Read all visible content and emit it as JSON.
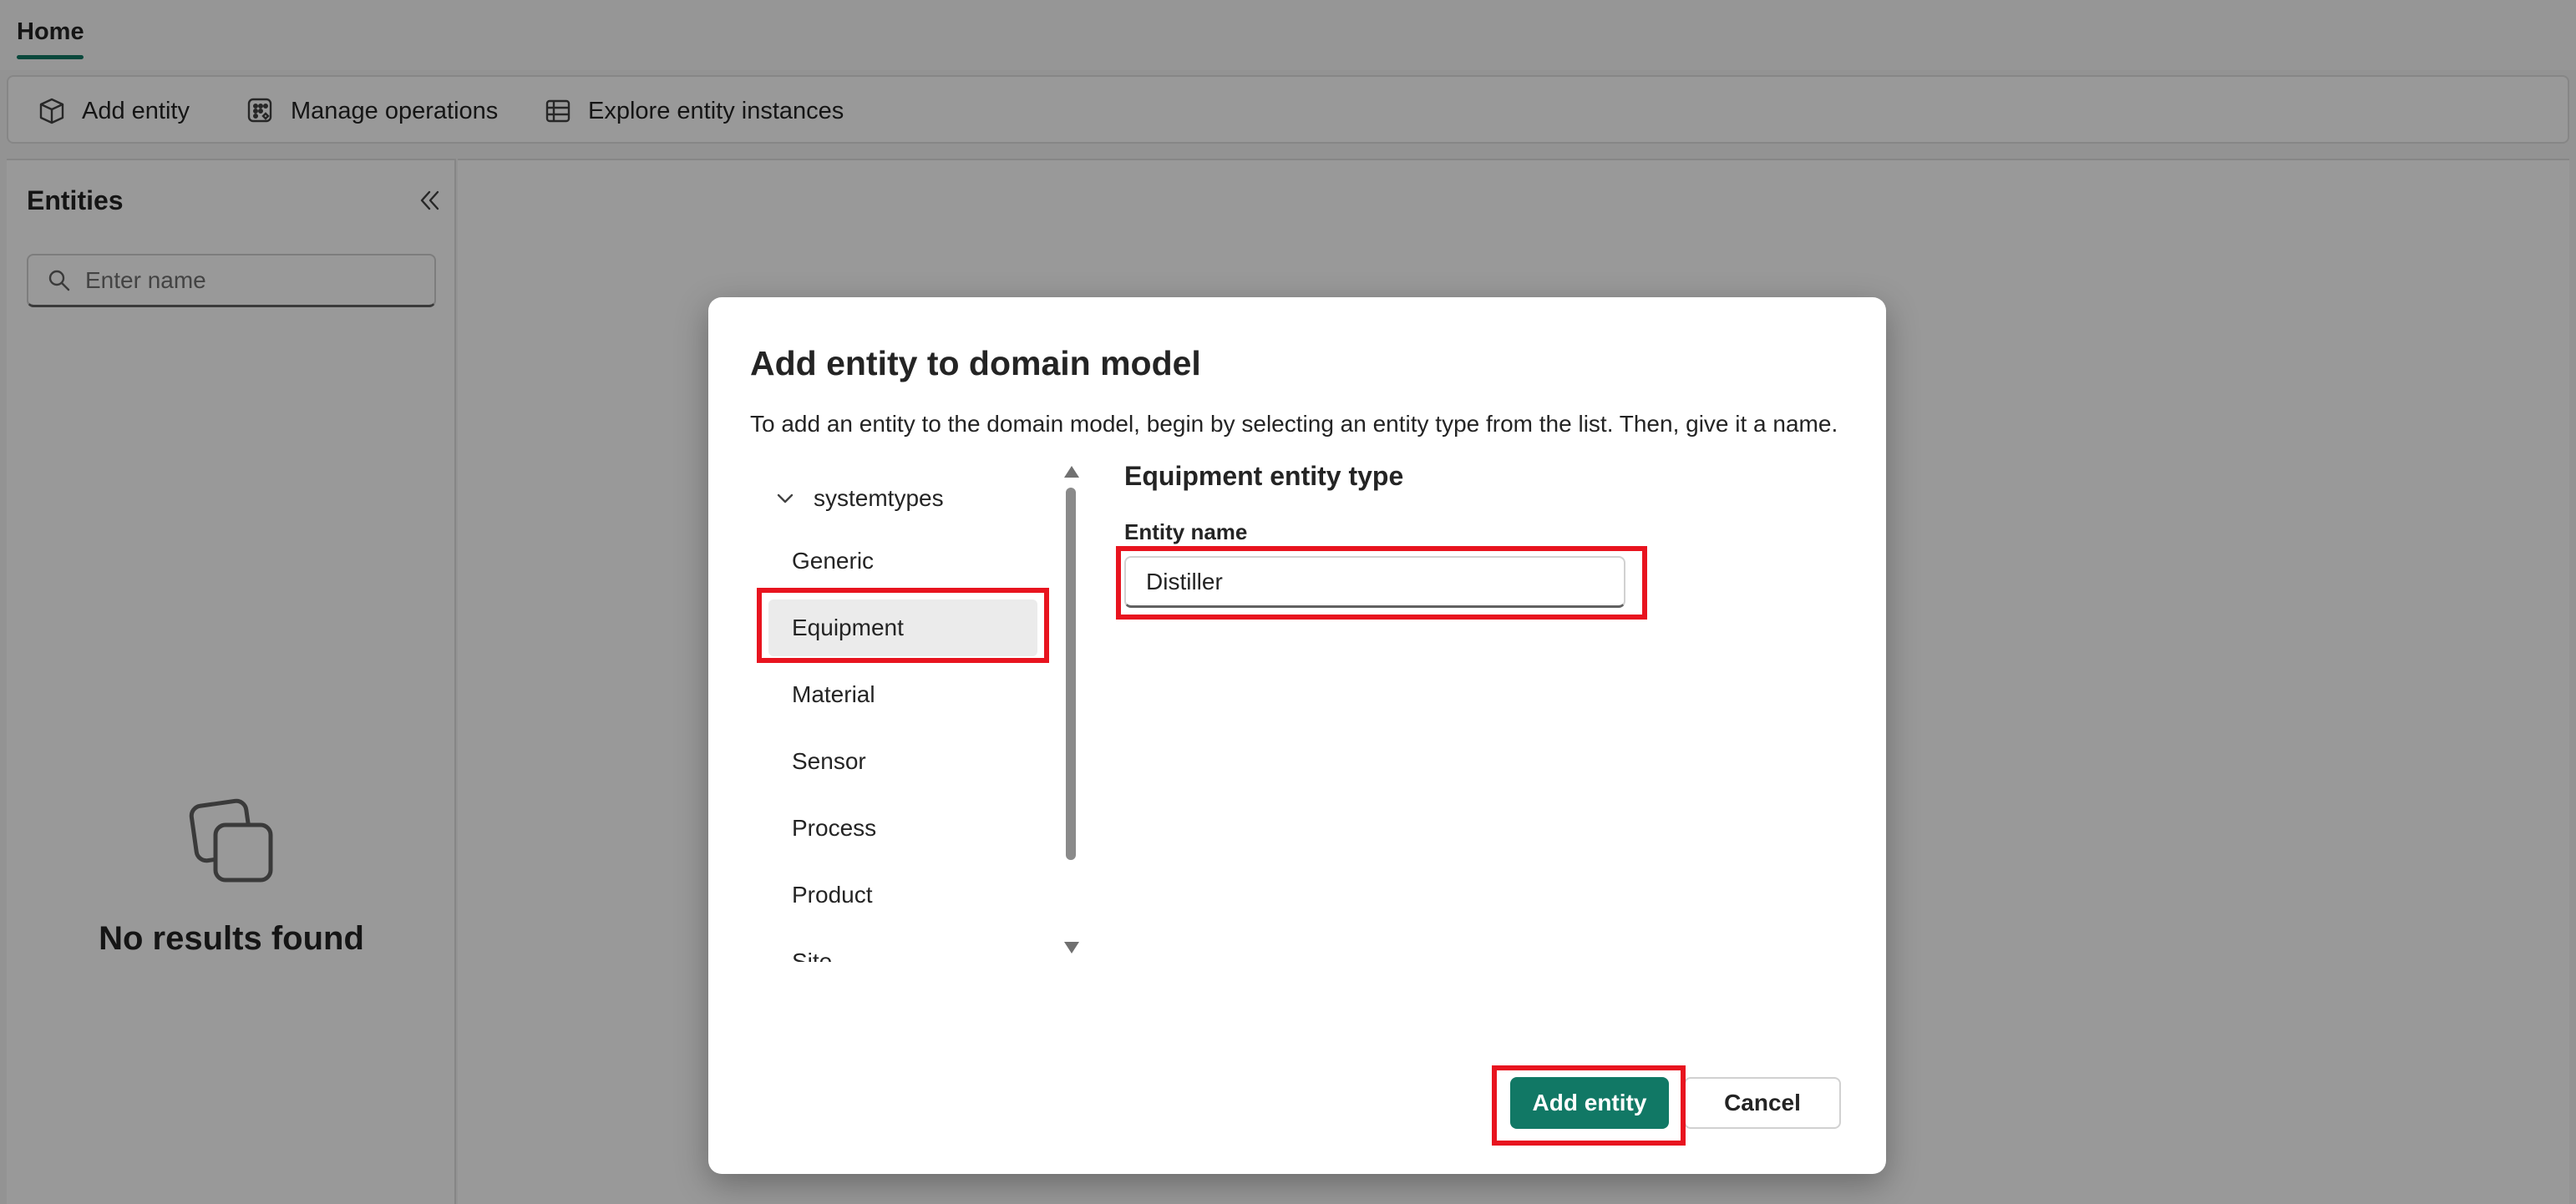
{
  "tabs": {
    "home": "Home"
  },
  "toolbar": {
    "add_entity": "Add entity",
    "manage_operations": "Manage operations",
    "explore_instances": "Explore entity instances"
  },
  "sidebar": {
    "title": "Entities",
    "search_placeholder": "Enter name",
    "empty_text": "No results found"
  },
  "dialog": {
    "title": "Add entity to domain model",
    "description": "To add an entity to the domain model, begin by selecting an entity type from the list. Then, give it a name.",
    "tree": {
      "root": "systemtypes",
      "items": [
        "Generic",
        "Equipment",
        "Material",
        "Sensor",
        "Process",
        "Product",
        "Site"
      ],
      "selected": "Equipment"
    },
    "type_heading": "Equipment entity type",
    "field_label": "Entity name",
    "field_value": "Distiller",
    "primary_button": "Add entity",
    "secondary_button": "Cancel"
  },
  "colors": {
    "accent": "#117865",
    "highlight": "#e8141f"
  }
}
